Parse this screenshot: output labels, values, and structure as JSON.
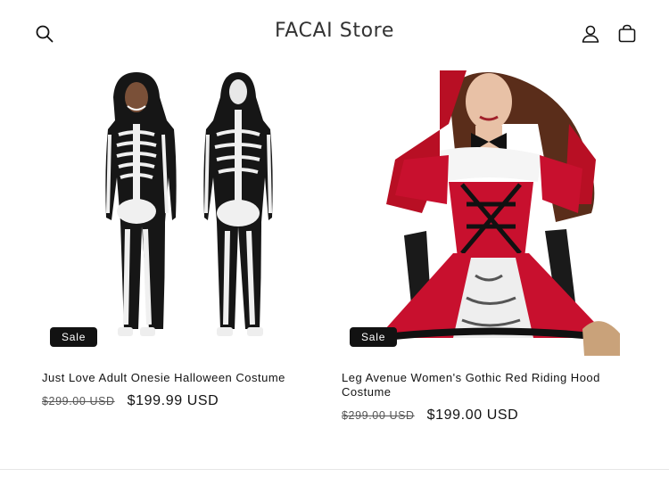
{
  "header": {
    "store_name": "FACAI Store",
    "icons": [
      "search-icon",
      "account-icon",
      "cart-icon"
    ]
  },
  "products": [
    {
      "title": "Just Love Adult Onesie Halloween Costume",
      "badge": "Sale",
      "compare_price": "$299.00 USD",
      "price": "$199.99 USD"
    },
    {
      "title": "Leg Avenue Women's Gothic Red Riding Hood Costume",
      "badge": "Sale",
      "compare_price": "$299.00 USD",
      "price": "$199.00 USD"
    }
  ],
  "colors": {
    "text": "#121212",
    "badge_bg": "#121212",
    "badge_text": "#ffffff",
    "costume_red": "#c8102e"
  }
}
